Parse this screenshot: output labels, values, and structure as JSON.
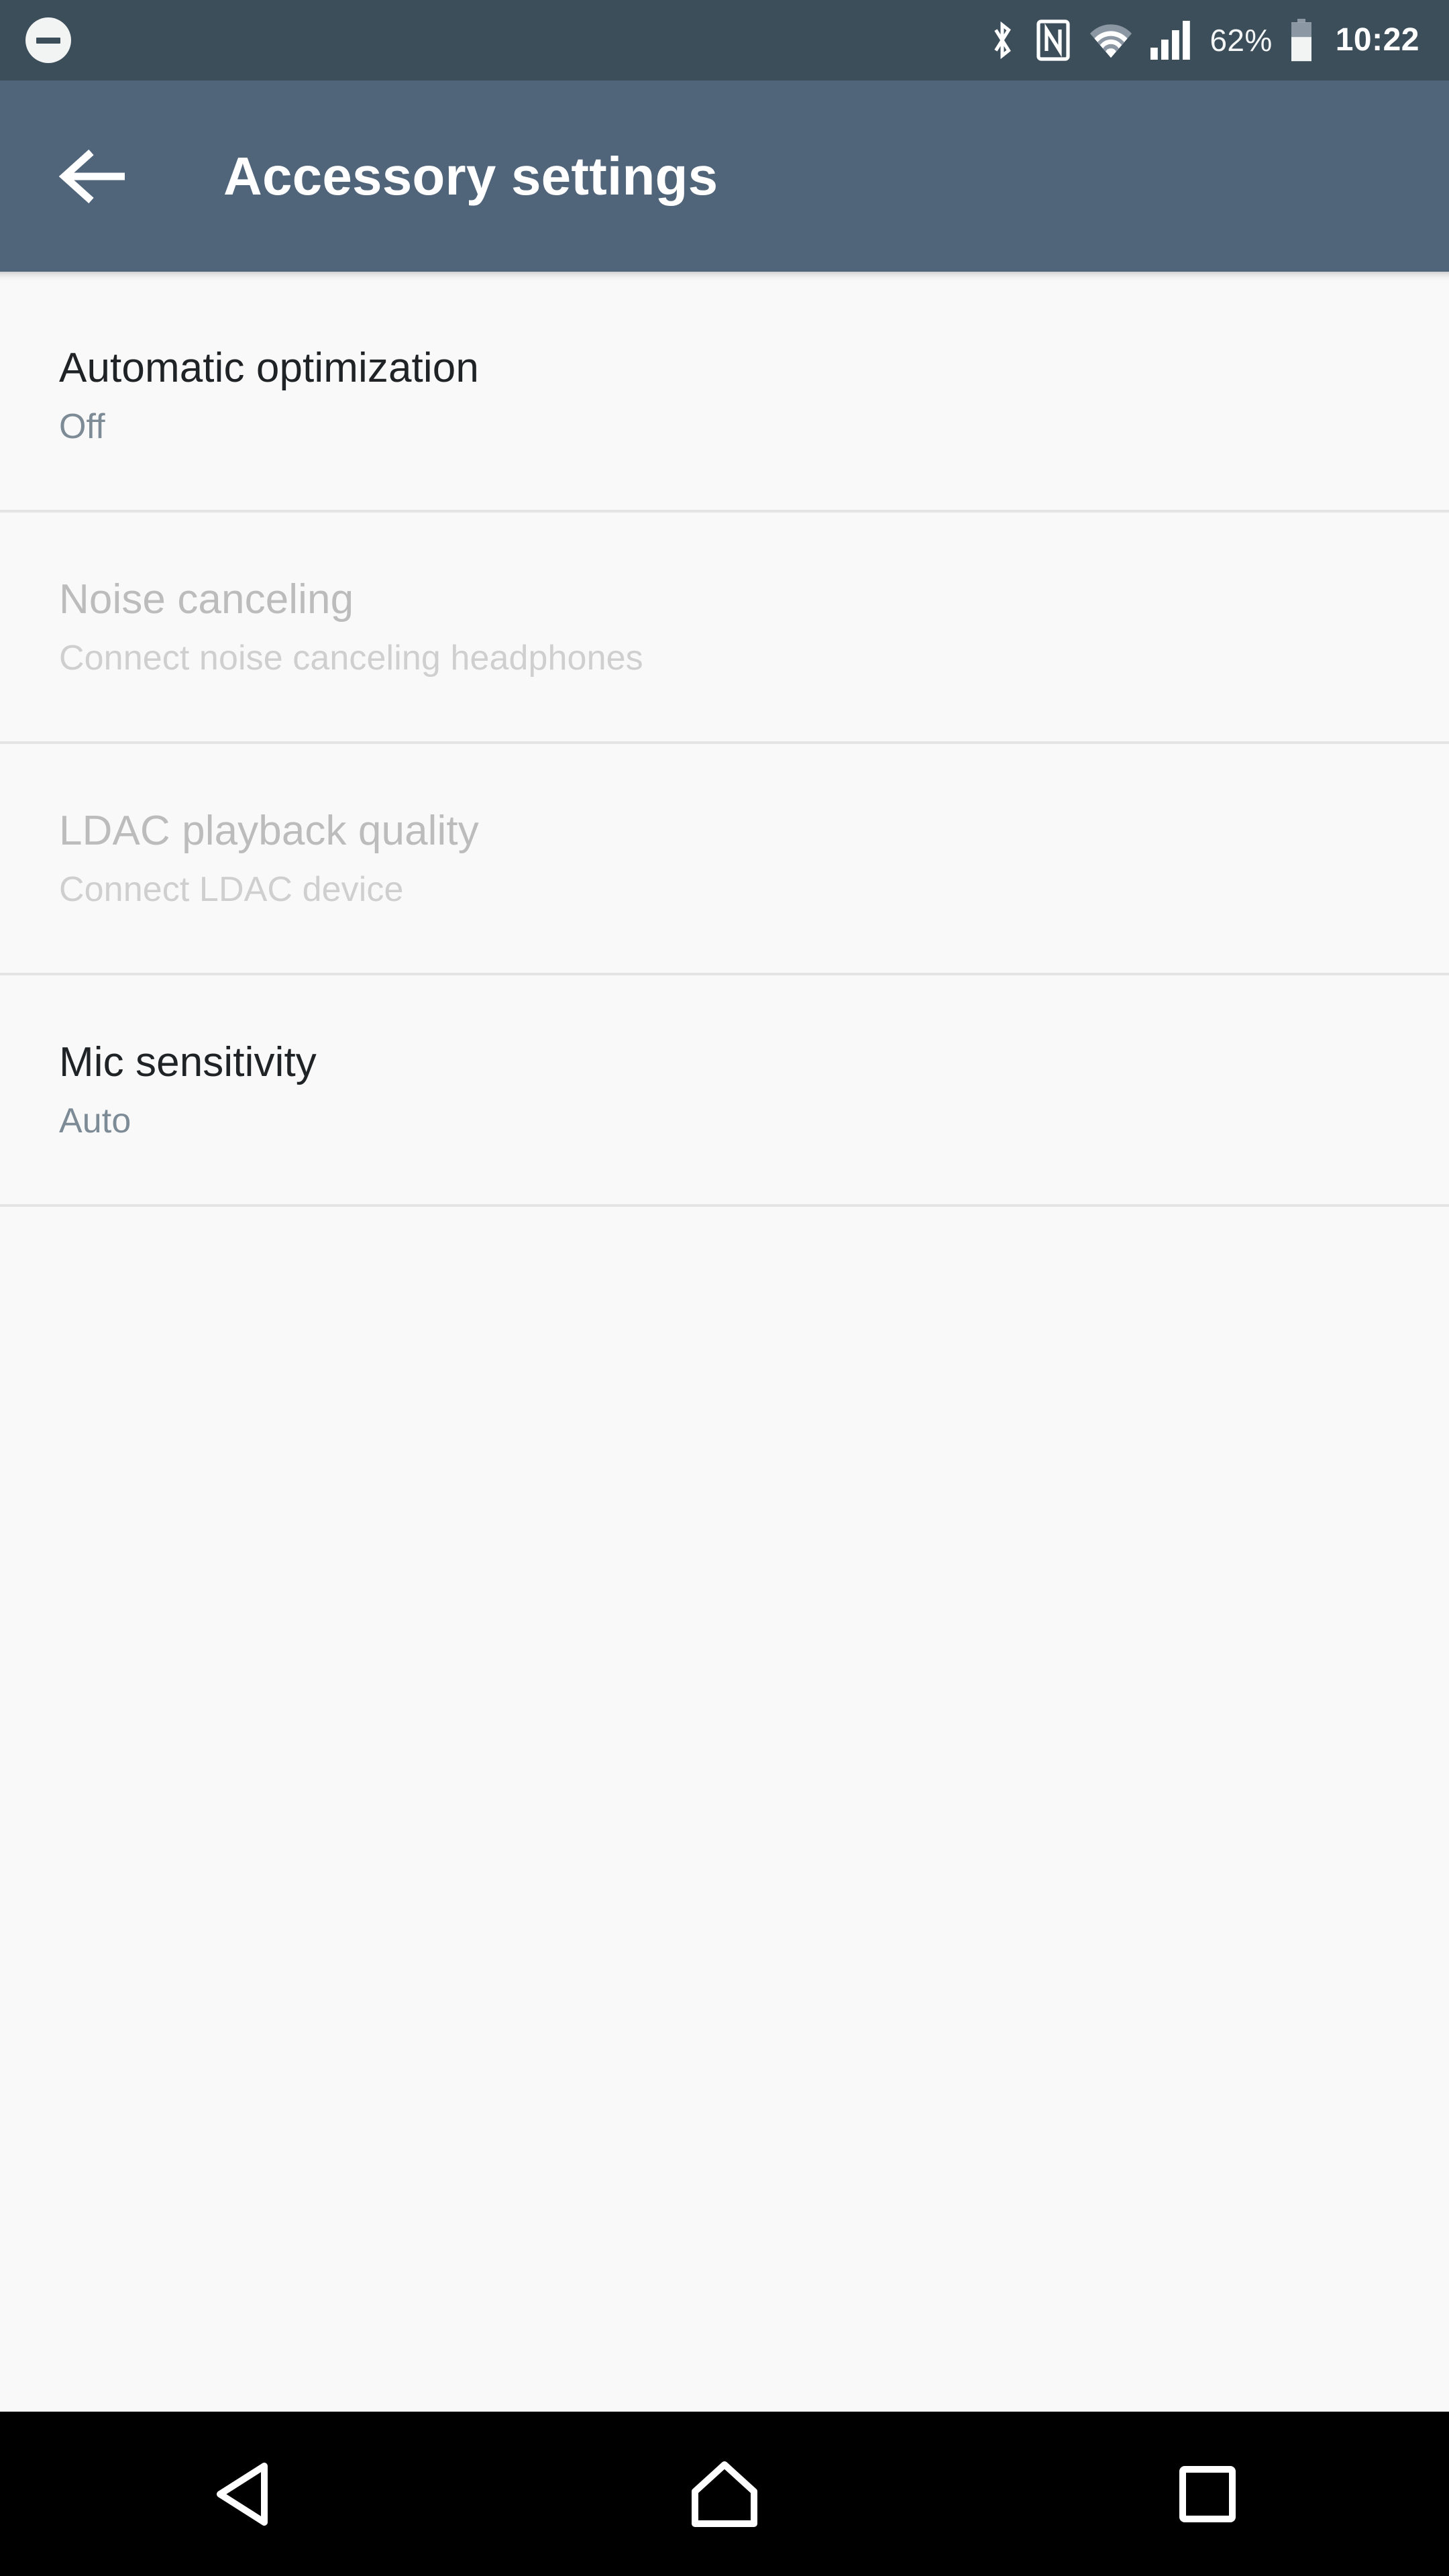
{
  "status_bar": {
    "dnd_icon": "do-not-disturb-icon",
    "icons": [
      "bluetooth-icon",
      "nfc-icon",
      "wifi-icon",
      "cellular-signal-icon"
    ],
    "battery_percent": "62%",
    "battery_icon": "battery-icon",
    "clock": "10:22"
  },
  "app_bar": {
    "back_icon": "back-arrow-icon",
    "title": "Accessory settings"
  },
  "settings": {
    "items": [
      {
        "title": "Automatic optimization",
        "summary": "Off",
        "enabled": true
      },
      {
        "title": "Noise canceling",
        "summary": "Connect noise canceling headphones",
        "enabled": false
      },
      {
        "title": "LDAC playback quality",
        "summary": "Connect LDAC device",
        "enabled": false
      },
      {
        "title": "Mic sensitivity",
        "summary": "Auto",
        "enabled": true
      }
    ]
  },
  "nav_bar": {
    "back": "nav-back-icon",
    "home": "nav-home-icon",
    "recents": "nav-recents-icon"
  },
  "colors": {
    "status_bar_bg": "#3c4e5a",
    "app_bar_bg": "#50647a",
    "page_bg": "#f9f9f9",
    "divider": "#e4e4e4",
    "title_text": "#1f2326",
    "summary_text": "#7c8b96",
    "disabled_title": "#bcbcbc",
    "disabled_summary": "#cfcfcf",
    "nav_bar_bg": "#000000"
  }
}
